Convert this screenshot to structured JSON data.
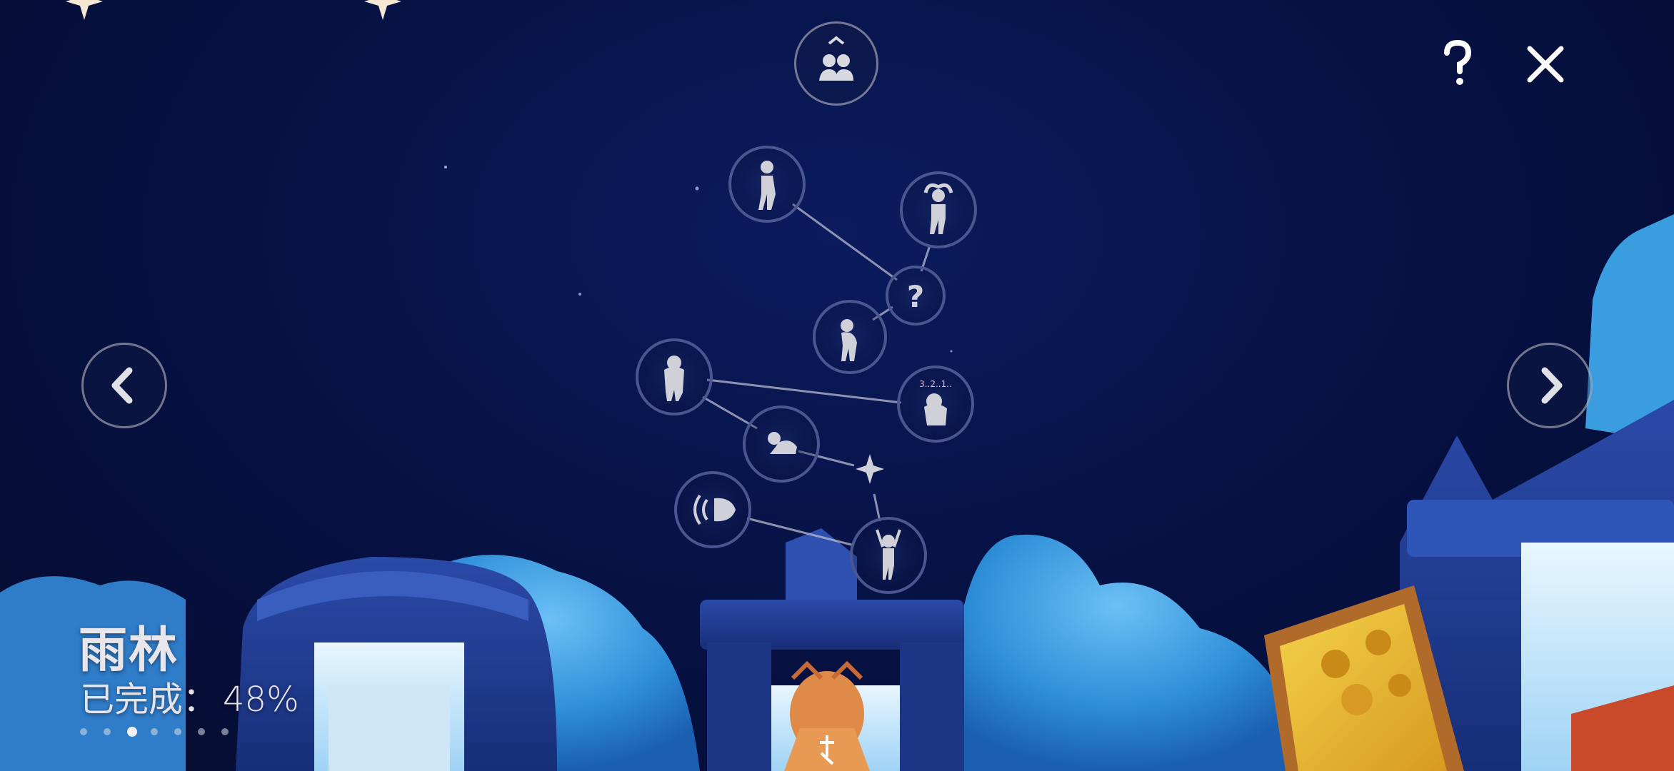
{
  "location": {
    "title": "雨林",
    "progress_label": "已完成：",
    "progress_value": "48%",
    "progress_fraction": 0.48
  },
  "page_indicator": {
    "count": 7,
    "active_index": 2
  },
  "top_bar": {
    "friends_button_icon": "friends-icon",
    "help_button_icon": "question-icon",
    "close_button_icon": "close-icon"
  },
  "navigation": {
    "prev_icon": "chevron-left-icon",
    "next_icon": "chevron-right-icon"
  },
  "constellation": {
    "nodes": [
      {
        "id": "spirit-1",
        "icon": "standing-spirit-icon",
        "state": "unlocked"
      },
      {
        "id": "spirit-2",
        "icon": "hands-on-head-spirit-icon",
        "state": "unlocked"
      },
      {
        "id": "spirit-3",
        "icon": "question-icon",
        "state": "locked"
      },
      {
        "id": "spirit-4",
        "icon": "hunched-spirit-icon",
        "state": "unlocked"
      },
      {
        "id": "spirit-5",
        "icon": "hooded-spirit-icon",
        "state": "unlocked"
      },
      {
        "id": "spirit-6",
        "icon": "countdown-spirit-icon",
        "state": "unlocked",
        "label": "3..2..1.."
      },
      {
        "id": "spirit-7",
        "icon": "bowing-spirit-icon",
        "state": "unlocked"
      },
      {
        "id": "spirit-8",
        "icon": "star-icon",
        "state": "star"
      },
      {
        "id": "spirit-9",
        "icon": "shouting-spirit-icon",
        "state": "unlocked"
      },
      {
        "id": "spirit-10",
        "icon": "cheering-spirit-icon",
        "state": "unlocked"
      }
    ]
  },
  "colors": {
    "sky_top": "#050c30",
    "sky_mid": "#0b1b5e",
    "cloud": "#2f8fd8",
    "ui_ring": "#c8c8d2",
    "icon": "#cfd0d8",
    "painting_frame": "#b06a2a",
    "painting_fill": "#e8c13a"
  }
}
